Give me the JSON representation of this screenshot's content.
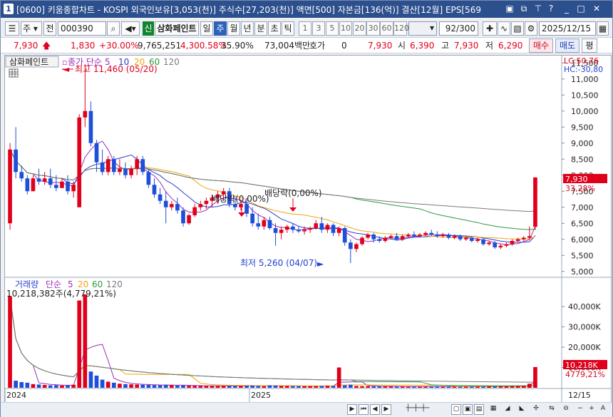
{
  "window": {
    "badge": "1",
    "title": "[0600] 키움종합차트 - KOSPI 외국인보유[3,053(천)] 주식수[27,203(천)] 액면[500] 자본금[136(억)] 결산[12월] EPS[569"
  },
  "toolbar": {
    "mode": "주",
    "ref": "전",
    "code": "000390",
    "badge": "신",
    "name": "삼화페인트",
    "periods": [
      "일",
      "주",
      "월",
      "년",
      "분",
      "초",
      "틱"
    ],
    "selected_period": "주",
    "intervals": [
      "1",
      "3",
      "5",
      "10",
      "20",
      "30",
      "60",
      "120"
    ],
    "count": "92",
    "count_total": "/300",
    "date": "2025/12/15"
  },
  "quote": {
    "price": "7,930",
    "arrow": "up",
    "change": "1,830",
    "pct": "+30.00%",
    "volume": "9,765,251",
    "vol_pct": "4,300.58%",
    "turnover": "35.90%",
    "amount": "73,004백만",
    "hoga_label": "호가",
    "hoga_val": "0",
    "hoga_price": "7,930",
    "open_label": "시",
    "open": "6,390",
    "high_label": "고",
    "high": "7,930",
    "low_label": "저",
    "low": "6,290",
    "buy": "매수",
    "sell": "매도",
    "eval": "평"
  },
  "price_panel": {
    "name_tag": "삼화페인트",
    "ma_label": "종가 단순",
    "ma_periods": [
      "5",
      "10",
      "20",
      "60",
      "120"
    ],
    "ma_colors": [
      "#9c2db8",
      "#2b3ed0",
      "#f2a20e",
      "#2e9a3c",
      "#7a7a7a"
    ],
    "high_note": "최고 11,460 (05/20)",
    "low_note": "최저 5,260 (04/07)",
    "div1": "배당락(0,00%)",
    "div2": "배당락(0,00%)",
    "lc": "LC:50,76",
    "hc": "HC:-30,80",
    "y_ticks": [
      "11,500",
      "11,000",
      "10,500",
      "10,000",
      "9,500",
      "9,000",
      "8,500",
      "8,000",
      "7,500",
      "7,000",
      "6,500",
      "6,000",
      "5,500",
      "5,000"
    ],
    "current_label": "7,930",
    "current_pct": "33,28%"
  },
  "volume_panel": {
    "title": "거래량",
    "ma_label": "단순",
    "ma_periods": [
      "5",
      "20",
      "60",
      "120"
    ],
    "info": "10,218,382주(4,779,21%)",
    "y_ticks": [
      "40,000K",
      "30,000K",
      "20,000K",
      "10,000K"
    ],
    "current_label": "10,218K",
    "current_pct": "4779,21%"
  },
  "x_axis": {
    "labels": [
      "2024",
      "2025"
    ],
    "end_label": "12/15"
  },
  "chart_data": {
    "type": "candlestick",
    "y_price_range": [
      4950,
      11550
    ],
    "y_volume_range": [
      0,
      46000
    ],
    "candles": [
      [
        6500,
        9000,
        6300,
        8800
      ],
      [
        8800,
        9500,
        7900,
        8100
      ],
      [
        8100,
        8300,
        7800,
        7900
      ],
      [
        7900,
        8000,
        7400,
        7500
      ],
      [
        7500,
        8000,
        7500,
        7900
      ],
      [
        7900,
        8200,
        7700,
        7800
      ],
      [
        7800,
        8100,
        7700,
        7900
      ],
      [
        7900,
        8200,
        7600,
        7700
      ],
      [
        7700,
        8000,
        7500,
        7600
      ],
      [
        7600,
        7900,
        7600,
        7800
      ],
      [
        7800,
        8000,
        7400,
        7500
      ],
      [
        7500,
        7800,
        7300,
        7700
      ],
      [
        7000,
        9900,
        7000,
        9800
      ],
      [
        9800,
        11460,
        9500,
        10000
      ],
      [
        10000,
        10300,
        8900,
        9000
      ],
      [
        9000,
        9100,
        8100,
        8400
      ],
      [
        8400,
        8800,
        8000,
        8100
      ],
      [
        8100,
        8600,
        8000,
        8500
      ],
      [
        8500,
        8600,
        8000,
        8100
      ],
      [
        8100,
        8500,
        8000,
        8200
      ],
      [
        8200,
        8400,
        7900,
        8000
      ],
      [
        8000,
        8300,
        7900,
        8200
      ],
      [
        8200,
        8600,
        8000,
        8500
      ],
      [
        8500,
        8600,
        8000,
        8100
      ],
      [
        8100,
        8200,
        7600,
        7700
      ],
      [
        7700,
        7900,
        7300,
        7400
      ],
      [
        7400,
        7600,
        7100,
        7200
      ],
      [
        7200,
        7500,
        6500,
        7000
      ],
      [
        7000,
        7200,
        6900,
        7100
      ],
      [
        7100,
        7300,
        6800,
        6900
      ],
      [
        6900,
        7000,
        6400,
        6500
      ],
      [
        6500,
        6800,
        6450,
        6750
      ],
      [
        6750,
        7100,
        6700,
        7000
      ],
      [
        7000,
        7200,
        6900,
        7100
      ],
      [
        7100,
        7300,
        6950,
        7200
      ],
      [
        7200,
        7400,
        7000,
        7300
      ],
      [
        7300,
        7500,
        7100,
        7400
      ],
      [
        7400,
        7600,
        7200,
        7500
      ],
      [
        7500,
        7600,
        7000,
        7100
      ],
      [
        7100,
        7300,
        6900,
        7000
      ],
      [
        7000,
        7200,
        6900,
        7100
      ],
      [
        7100,
        7300,
        6700,
        6800
      ],
      [
        6800,
        7000,
        6400,
        6500
      ],
      [
        6500,
        6800,
        6300,
        6400
      ],
      [
        6400,
        6700,
        6300,
        6600
      ],
      [
        6600,
        6700,
        6300,
        6350
      ],
      [
        6350,
        6500,
        5800,
        6200
      ],
      [
        6200,
        6400,
        6000,
        6300
      ],
      [
        6300,
        6450,
        6200,
        6400
      ],
      [
        6400,
        6500,
        6200,
        6300
      ],
      [
        6300,
        6400,
        6200,
        6250
      ],
      [
        6250,
        6400,
        6150,
        6300
      ],
      [
        6300,
        6400,
        6200,
        6350
      ],
      [
        6350,
        6600,
        6300,
        6500
      ],
      [
        6500,
        6700,
        6200,
        6300
      ],
      [
        6300,
        6500,
        6200,
        6450
      ],
      [
        6450,
        6500,
        6100,
        6200
      ],
      [
        6200,
        6400,
        6100,
        6350
      ],
      [
        6350,
        6400,
        5800,
        5900
      ],
      [
        5900,
        6000,
        5260,
        5700
      ],
      [
        5700,
        5900,
        5600,
        5850
      ],
      [
        5850,
        6100,
        5800,
        6050
      ],
      [
        6050,
        6200,
        6000,
        6150
      ],
      [
        6150,
        6200,
        5900,
        6000
      ],
      [
        6000,
        6100,
        5900,
        5950
      ],
      [
        5950,
        6100,
        5900,
        6050
      ],
      [
        6050,
        6150,
        6000,
        6100
      ],
      [
        6100,
        6200,
        5950,
        6000
      ],
      [
        6000,
        6150,
        5950,
        6100
      ],
      [
        6100,
        6200,
        6050,
        6150
      ],
      [
        6150,
        6250,
        6050,
        6100
      ],
      [
        6100,
        6200,
        6050,
        6150
      ],
      [
        6150,
        6250,
        6100,
        6200
      ],
      [
        6200,
        6300,
        6100,
        6150
      ],
      [
        6150,
        6250,
        6050,
        6100
      ],
      [
        6100,
        6200,
        6050,
        6150
      ],
      [
        6150,
        6200,
        6000,
        6050
      ],
      [
        6050,
        6150,
        6000,
        6100
      ],
      [
        6100,
        6150,
        5950,
        6000
      ],
      [
        6000,
        6100,
        5950,
        6050
      ],
      [
        6050,
        6100,
        5900,
        5950
      ],
      [
        5950,
        6050,
        5900,
        6000
      ],
      [
        6000,
        6050,
        5800,
        5850
      ],
      [
        5850,
        5950,
        5800,
        5900
      ],
      [
        5900,
        5950,
        5700,
        5750
      ],
      [
        5750,
        5850,
        5700,
        5800
      ],
      [
        5800,
        5900,
        5750,
        5850
      ],
      [
        5850,
        6000,
        5800,
        5950
      ],
      [
        5950,
        6050,
        5900,
        6000
      ],
      [
        6000,
        6100,
        5950,
        6050
      ],
      [
        6050,
        6400,
        6000,
        6100
      ],
      [
        6390,
        7930,
        6290,
        7930
      ]
    ],
    "volumes": [
      45000,
      3500,
      2800,
      2500,
      1800,
      1600,
      1400,
      1200,
      1300,
      1100,
      1200,
      1500,
      43000,
      46000,
      8000,
      6000,
      4000,
      3000,
      2500,
      2000,
      1800,
      1700,
      1600,
      1500,
      1400,
      1300,
      1200,
      1500,
      1300,
      1100,
      1200,
      1000,
      1000,
      900,
      900,
      900,
      900,
      900,
      900,
      900,
      900,
      1000,
      1100,
      900,
      800,
      1200,
      1100,
      900,
      900,
      800,
      800,
      800,
      800,
      800,
      900,
      1000,
      900,
      10000,
      1200,
      1500,
      900,
      800,
      800,
      700,
      700,
      700,
      700,
      600,
      600,
      600,
      600,
      600,
      600,
      600,
      600,
      600,
      600,
      600,
      600,
      600,
      600,
      600,
      600,
      700,
      700,
      700,
      700,
      800,
      900,
      1000,
      2000,
      10218
    ]
  }
}
